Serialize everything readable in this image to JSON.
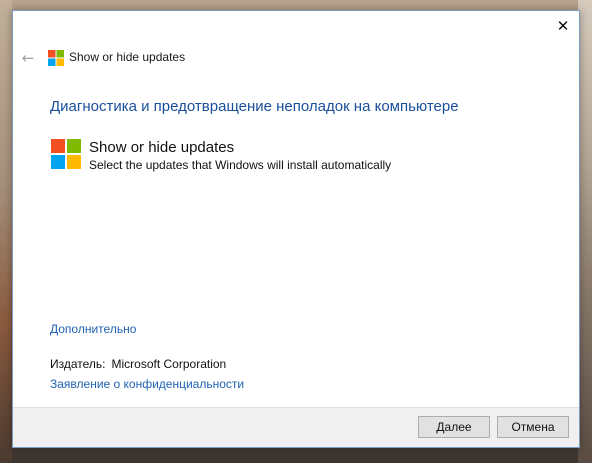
{
  "window": {
    "close_glyph": "✕"
  },
  "navbar": {
    "back_glyph": "←",
    "title": "Show or hide updates"
  },
  "main": {
    "heading": "Диагностика и предотвращение неполадок на компьютере",
    "item_title": "Show or hide updates",
    "item_description": "Select the updates that Windows will install automatically",
    "more_link": "Дополнительно",
    "publisher_label": "Издатель:",
    "publisher_value": "Microsoft Corporation",
    "privacy_link": "Заявление о конфиденциальности"
  },
  "footer": {
    "next_label": "Далее",
    "cancel_label": "Отмена"
  },
  "colors": {
    "heading": "#1a4f9c",
    "link": "#1f62b3",
    "logo_red": "#f25022",
    "logo_green": "#7fba00",
    "logo_blue": "#00a4ef",
    "logo_yellow": "#ffb900"
  },
  "icons": [
    "close-icon",
    "back-arrow-icon",
    "windows-logo-icon"
  ]
}
